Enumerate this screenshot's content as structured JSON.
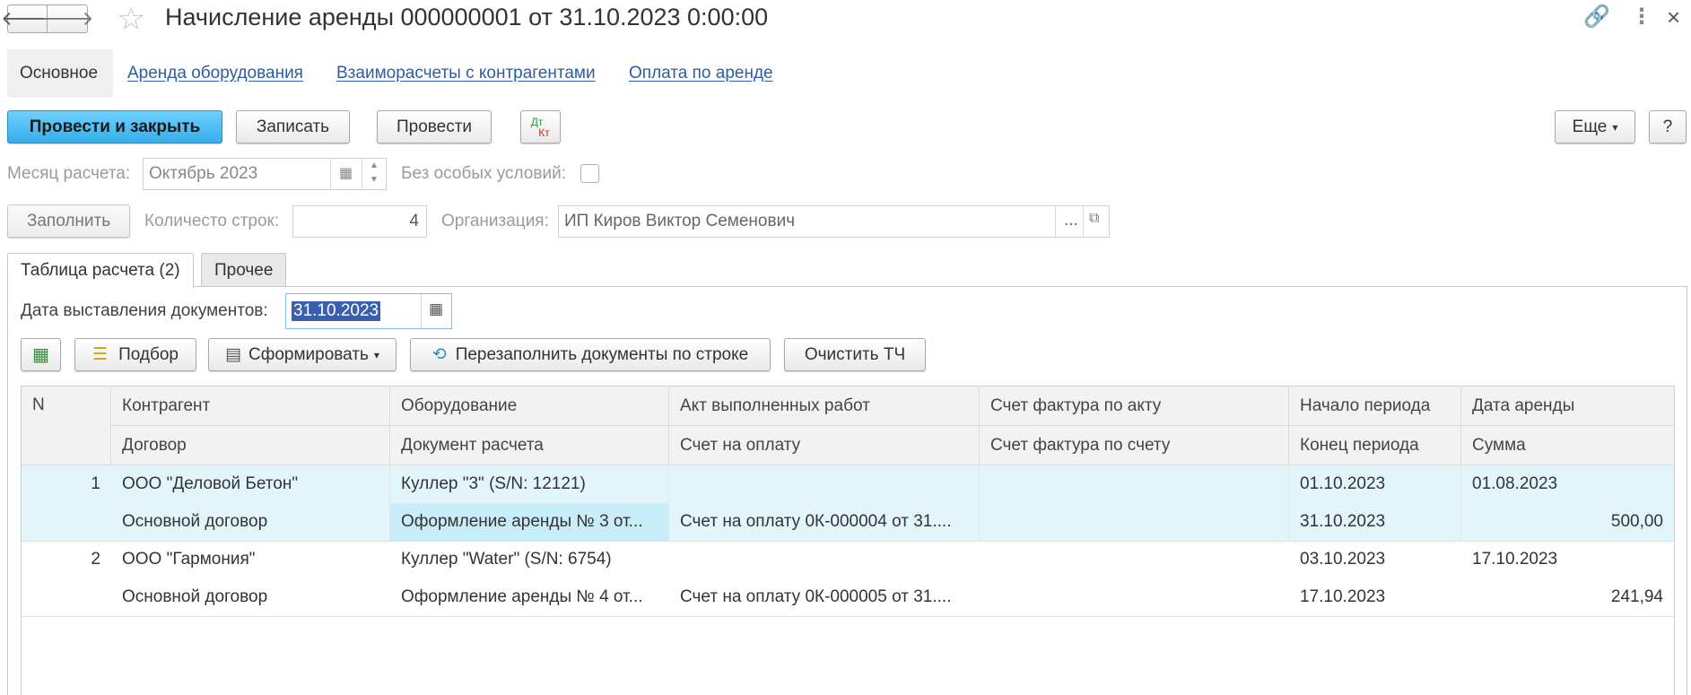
{
  "window": {
    "title": "Начисление аренды 000000001 от 31.10.2023 0:00:00",
    "back_icon": "🡐",
    "forward_icon": "🡒",
    "star_icon": "☆",
    "link_icon": "🔗",
    "more_icon": "⋮",
    "close_icon": "×"
  },
  "section_tabs": {
    "main": "Основное",
    "links": [
      "Аренда оборудования",
      "Взаиморасчеты с контрагентами",
      "Оплата по аренде"
    ]
  },
  "toolbar": {
    "post_close": "Провести и закрыть",
    "save": "Записать",
    "post": "Провести",
    "dt_label": "Дт",
    "kt_label": "Кт",
    "more": "Еще",
    "help": "?"
  },
  "form": {
    "month_label": "Месяц расчета:",
    "month_value": "Октябрь 2023",
    "no_special_label": "Без особых условий:",
    "fill_button": "Заполнить",
    "rows_count_label": "Количесто строк:",
    "rows_count_value": "4",
    "org_label": "Организация:",
    "org_value": "ИП Киров Виктор Семенович",
    "org_select": "...",
    "org_open": "⧉"
  },
  "inner_tabs": {
    "calc_table": "Таблица расчета (2)",
    "other": "Прочее"
  },
  "doc_date": {
    "label": "Дата выставления документов:",
    "value": "31.10.2023"
  },
  "table_toolbar": {
    "pick": "Подбор",
    "generate": "Сформировать",
    "refill": "Перезаполнить документы по строке",
    "clear": "Очистить ТЧ"
  },
  "table": {
    "headers_top": [
      "N",
      "Контрагент",
      "Оборудование",
      "Акт выполненных работ",
      "Счет фактура по акту",
      "Начало периода",
      "Дата аренды"
    ],
    "headers_bottom": [
      "Договор",
      "Документ расчета",
      "Счет на оплату",
      "Счет фактура по счету",
      "Конец периода",
      "Сумма"
    ],
    "rows": [
      {
        "n": "1",
        "counterparty": "ООО \"Деловой Бетон\"",
        "equipment": "Куллер \"3\" (S/N: 12121)",
        "act": "",
        "invoice_act": "",
        "period_start": "01.10.2023",
        "rent_date": "01.08.2023",
        "contract": "Основной договор",
        "calc_doc": "Оформление аренды № 3 от...",
        "payment_invoice": "Счет на оплату 0К-000004 от 31....",
        "invoice_bill": "",
        "period_end": "31.10.2023",
        "sum": "500,00"
      },
      {
        "n": "2",
        "counterparty": "ООО \"Гармония\"",
        "equipment": "Куллер \"Water\" (S/N: 6754)",
        "act": "",
        "invoice_act": "",
        "period_start": "03.10.2023",
        "rent_date": "17.10.2023",
        "contract": "Основной договор",
        "calc_doc": "Оформление аренды № 4 от...",
        "payment_invoice": "Счет на оплату 0К-000005 от 31....",
        "invoice_bill": "",
        "period_end": "17.10.2023",
        "sum": "241,94"
      }
    ]
  }
}
